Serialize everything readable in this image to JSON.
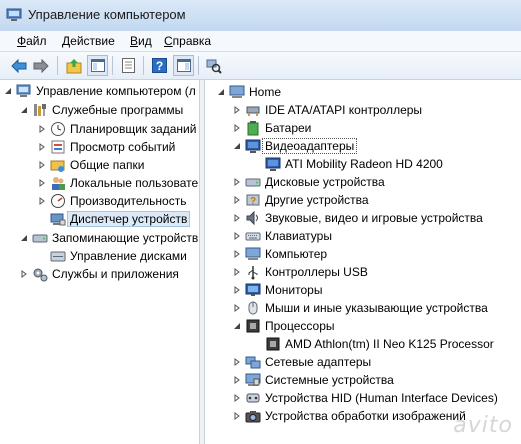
{
  "window": {
    "title": "Управление компьютером"
  },
  "menu": [
    {
      "first": "Ф",
      "rest": "айл"
    },
    {
      "first": "Д",
      "rest": "ействие"
    },
    {
      "first": "В",
      "rest": "ид"
    },
    {
      "first": "С",
      "rest": "правка"
    }
  ],
  "left_tree": {
    "root": "Управление компьютером (л",
    "services": "Служебные программы",
    "scheduler": "Планировщик заданий",
    "events": "Просмотр событий",
    "shared": "Общие папки",
    "users": "Локальные пользовате",
    "perf": "Производительность",
    "devmgr": "Диспетчер устройств",
    "storage": "Запоминающие устройств",
    "diskmgmt": "Управление дисками",
    "apps": "Службы и приложения"
  },
  "right_tree": {
    "home": "Home",
    "ide": "IDE ATA/ATAPI контроллеры",
    "batteries": "Батареи",
    "video": "Видеоадаптеры",
    "video_child": "ATI Mobility Radeon HD 4200",
    "disks": "Дисковые устройства",
    "other": "Другие устройства",
    "sound": "Звуковые, видео и игровые устройства",
    "keyboards": "Клавиатуры",
    "computer": "Компьютер",
    "usb": "Контроллеры USB",
    "monitors": "Мониторы",
    "mice": "Мыши и иные указывающие устройства",
    "cpu": "Процессоры",
    "cpu_child": "AMD Athlon(tm) II Neo K125 Processor",
    "network": "Сетевые адаптеры",
    "system": "Системные устройства",
    "hid": "Устройства HID (Human Interface Devices)",
    "imaging": "Устройства обработки изображений"
  },
  "watermark": "avito",
  "colors": {
    "title_bg": "#c2d8f0",
    "selection": "#dceaf8",
    "accent": "#2b6cc4"
  }
}
